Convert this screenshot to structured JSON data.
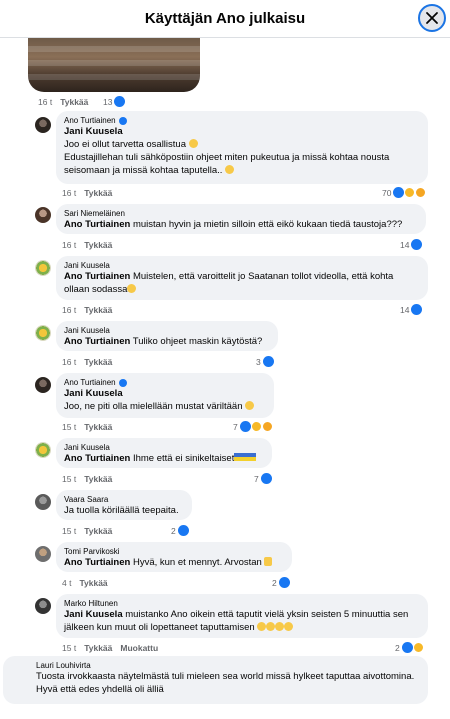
{
  "header": {
    "title": "Käyttäjän Ano julkaisu"
  },
  "colors": {
    "accent": "#1877f2",
    "bubble": "#f0f2f5",
    "meta": "#65676b"
  },
  "post": {
    "time": "16 t",
    "like_label": "Tykkää",
    "likes": "13"
  },
  "comments": [
    {
      "author": "Ano Turtiainen",
      "verified": true,
      "mention": "Jani Kuusela",
      "text": "Joo ei ollut tarvetta osallistua",
      "text2": "Edustajillehan tuli sähköpostiin ohjeet miten pukeutua ja missä kohtaa nousta seisomaan ja missä kohtaa taputella..",
      "time": "16 t",
      "like_label": "Tykkää",
      "count": "70"
    },
    {
      "author": "Sari Niemeläinen",
      "mention": "Ano Turtiainen",
      "text": "muistan hyvin ja mietin silloin että eikö kukaan tiedä taustoja???",
      "time": "16 t",
      "like_label": "Tykkää",
      "count": "14"
    },
    {
      "author": "Jani Kuusela",
      "mention": "Ano Turtiainen",
      "text": "Muistelen, että varoittelit jo Saatanan tollot videolla, että kohta ollaan sodassa",
      "time": "16 t",
      "like_label": "Tykkää",
      "count": "14"
    },
    {
      "author": "Jani Kuusela",
      "mention": "Ano Turtiainen",
      "text": "Tuliko ohjeet maskin käytöstä?",
      "time": "16 t",
      "like_label": "Tykkää",
      "count": "3"
    },
    {
      "author": "Ano Turtiainen",
      "verified": true,
      "mention": "Jani Kuusela",
      "text": "Joo, ne piti olla mielellään mustat väriltään",
      "time": "15 t",
      "like_label": "Tykkää",
      "count": "7"
    },
    {
      "author": "Jani Kuusela",
      "mention": "Ano Turtiainen",
      "text": "Ihme että ei sinikeltaiset",
      "time": "15 t",
      "like_label": "Tykkää",
      "count": "7"
    },
    {
      "author": "Vaara Saara",
      "text": "Ja tuolla köriläällä teepaita.",
      "time": "15 t",
      "like_label": "Tykkää",
      "count": "2"
    },
    {
      "author": "Tomi Parvikoski",
      "mention": "Ano Turtiainen",
      "text": "Hyvä, kun et mennyt. Arvostan",
      "time": "4 t",
      "like_label": "Tykkää",
      "count": "2"
    },
    {
      "author": "Marko Hiltunen",
      "mention": "Jani Kuusela",
      "text": "muistanko Ano oikein että taputit vielä yksin seisten 5 minuuttia sen jälkeen kun muut oli lopettaneet taputtamisen",
      "time": "15 t",
      "like_label": "Tykkää",
      "edited": "Muokattu",
      "count": "2"
    },
    {
      "author": "Lauri Louhivirta",
      "text": "Tuosta irvokkaasta näytelmästä tuli mieleen sea world missä hylkeet taputtaa aivottomina. Hyvä että edes yhdellä oli älliä"
    }
  ]
}
